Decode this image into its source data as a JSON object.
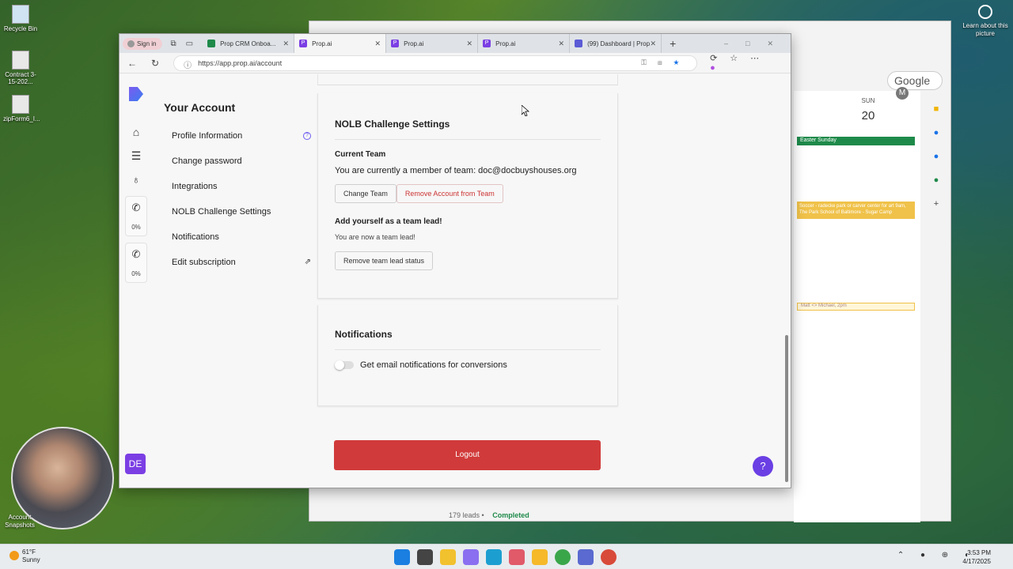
{
  "desktop": {
    "icons": [
      {
        "label": "Recycle Bin"
      },
      {
        "label": "Contract 3-15-202..."
      },
      {
        "label": "zipForm6_I..."
      }
    ],
    "learn_label": "Learn about this picture",
    "snapshots_label": "Account Snapshots"
  },
  "bg_window": {
    "google_label": "Google",
    "avatar_letter": "M",
    "day_name": "SUN",
    "day_number": "20",
    "event_easter": "Easter Sunday",
    "event_soccer": "Soccer - radecke park or carver center for art 9am, The Park School of Baltimore - Sugar Camp",
    "event_matt": "Matt <> Michael, 2pm",
    "leads_text": "179 leads •",
    "completed_text": "Completed"
  },
  "browser": {
    "signin_label": "Sign in",
    "tabs": [
      {
        "title": "Prop CRM Onboa...",
        "active": false,
        "fav": "g"
      },
      {
        "title": "Prop.ai",
        "active": true,
        "fav": "p"
      },
      {
        "title": "Prop.ai",
        "active": false,
        "fav": "p"
      },
      {
        "title": "Prop.ai",
        "active": false,
        "fav": "p"
      },
      {
        "title": "(99) Dashboard | Prop...",
        "active": false,
        "fav": "b"
      }
    ],
    "url": "https://app.prop.ai/account"
  },
  "account": {
    "heading": "Your Account",
    "menu": [
      {
        "label": "Profile Information"
      },
      {
        "label": "Change password"
      },
      {
        "label": "Integrations"
      },
      {
        "label": "NOLB Challenge Settings"
      },
      {
        "label": "Notifications"
      },
      {
        "label": "Edit subscription"
      }
    ]
  },
  "rail": {
    "call_pct_1": "0%",
    "call_pct_2": "0%",
    "avatar_initials": "DE"
  },
  "nolb": {
    "title": "NOLB Challenge Settings",
    "current_team_label": "Current Team",
    "current_team_text": "You are currently a member of team: doc@docbuyshouses.org",
    "change_team_label": "Change Team",
    "remove_team_label": "Remove Account from Team",
    "team_lead_label": "Add yourself as a team lead!",
    "team_lead_status": "You are now a team lead!",
    "remove_lead_label": "Remove team lead status"
  },
  "notifications": {
    "title": "Notifications",
    "email_toggle_label": "Get email notifications for conversions",
    "email_toggle_on": false
  },
  "logout_label": "Logout",
  "taskbar": {
    "temperature": "61°F",
    "condition": "Sunny",
    "time": "3:53 PM",
    "date": "4/17/2025",
    "badge": "49"
  },
  "colors": {
    "accent": "#7b3fe4",
    "danger": "#d13a3a",
    "calendar_green": "#1e8a4a",
    "calendar_yellow": "#f0c24a"
  }
}
